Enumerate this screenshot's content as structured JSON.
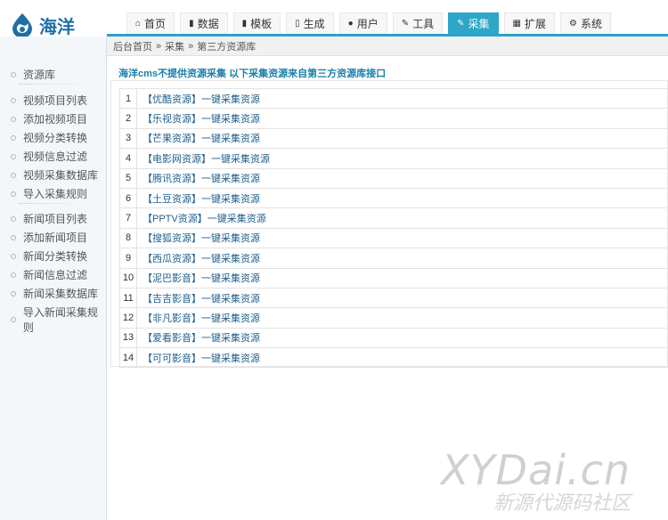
{
  "brand": {
    "name": "海洋",
    "logo_icon": "water-drop-icon"
  },
  "nav": {
    "tabs": [
      {
        "label": "首页",
        "icon": "home-icon",
        "glyph": "⌂",
        "active": false
      },
      {
        "label": "数据",
        "icon": "book-icon",
        "glyph": "▮",
        "active": false
      },
      {
        "label": "模板",
        "icon": "file-icon",
        "glyph": "▮",
        "active": false
      },
      {
        "label": "生成",
        "icon": "document-icon",
        "glyph": "▯",
        "active": false
      },
      {
        "label": "用户",
        "icon": "user-icon",
        "glyph": "●",
        "active": false
      },
      {
        "label": "工具",
        "icon": "wrench-icon",
        "glyph": "✎",
        "active": false
      },
      {
        "label": "采集",
        "icon": "edit-icon",
        "glyph": "✎",
        "active": true
      },
      {
        "label": "扩展",
        "icon": "sitemap-icon",
        "glyph": "▦",
        "active": false
      },
      {
        "label": "系统",
        "icon": "gear-icon",
        "glyph": "⚙",
        "active": false
      }
    ],
    "active_color": "#2da6c8"
  },
  "breadcrumb": {
    "items": [
      "后台首页",
      "采集",
      "第三方资源库"
    ],
    "separator": "»"
  },
  "sidebar": {
    "group1": [
      "资源库"
    ],
    "group2": [
      "视频项目列表",
      "添加视频项目",
      "视频分类转换",
      "视频信息过滤",
      "视频采集数据库",
      "导入采集规则"
    ],
    "group3": [
      "新闻项目列表",
      "添加新闻项目",
      "新闻分类转换",
      "新闻信息过滤",
      "新闻采集数据库",
      "导入新闻采集规则"
    ]
  },
  "notice": "海洋cms不提供资源采集 以下采集资源来自第三方资源库接口",
  "sources": [
    {
      "num": "1",
      "label": "【优酷资源】一键采集资源"
    },
    {
      "num": "2",
      "label": "【乐视资源】一键采集资源"
    },
    {
      "num": "3",
      "label": "【芒果资源】一键采集资源"
    },
    {
      "num": "4",
      "label": "【电影网资源】一键采集资源"
    },
    {
      "num": "5",
      "label": "【腾讯资源】一键采集资源"
    },
    {
      "num": "6",
      "label": "【土豆资源】一键采集资源"
    },
    {
      "num": "7",
      "label": "【PPTV资源】一键采集资源"
    },
    {
      "num": "8",
      "label": "【搜狐资源】一键采集资源"
    },
    {
      "num": "9",
      "label": "【西瓜资源】一键采集资源"
    },
    {
      "num": "10",
      "label": "【泥巴影音】一键采集资源"
    },
    {
      "num": "11",
      "label": "【吉吉影音】一键采集资源"
    },
    {
      "num": "12",
      "label": "【非凡影音】一键采集资源"
    },
    {
      "num": "13",
      "label": "【爱看影音】一键采集资源"
    },
    {
      "num": "14",
      "label": "【可可影音】一键采集资源"
    }
  ],
  "watermark": {
    "line1": "XYDai.cn",
    "line2": "新源代源码社区"
  }
}
